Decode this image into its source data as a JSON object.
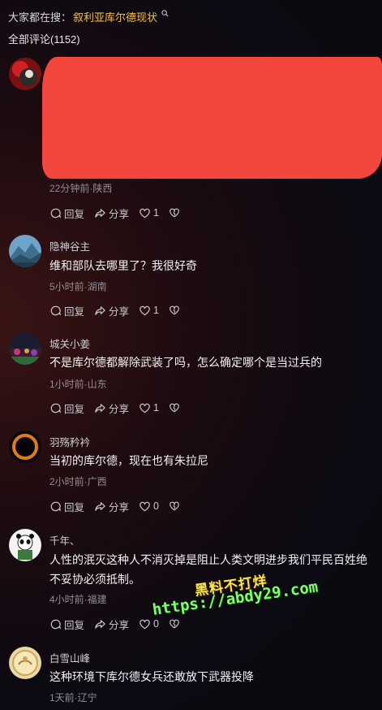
{
  "search": {
    "prefix": "大家都在搜：",
    "term": "叙利亚库尔德现状"
  },
  "comments_header": {
    "label": "全部评论(1152)"
  },
  "comments": [
    {
      "name": "",
      "text": "",
      "meta": "22分钟前·陕西",
      "reply_label": "回复",
      "share_label": "分享",
      "likes": "1"
    },
    {
      "name": "隐神谷主",
      "text": "维和部队去哪里了？我很好奇",
      "meta": "5小时前·湖南",
      "reply_label": "回复",
      "share_label": "分享",
      "likes": "1"
    },
    {
      "name": "城关小姜",
      "text": "不是库尔德都解除武装了吗，怎么确定哪个是当过兵的",
      "meta": "1小时前·山东",
      "reply_label": "回复",
      "share_label": "分享",
      "likes": "1"
    },
    {
      "name": "羽殇矜衿",
      "text": "当初的库尔德，现在也有朱拉尼",
      "meta": "2小时前·广西",
      "reply_label": "回复",
      "share_label": "分享",
      "likes": "0"
    },
    {
      "name": "千年、",
      "text": "人性的泯灭这种人不消灭掉是阻止人类文明进步我们平民百姓绝不妥协必须抵制。",
      "meta": "4小时前·福建",
      "reply_label": "回复",
      "share_label": "分享",
      "likes": "0"
    },
    {
      "name": "白雪山峰",
      "text": "这种环境下库尔德女兵还敢放下武器投降",
      "meta": "1天前·辽宁"
    }
  ],
  "watermark": {
    "title": "黑料不打烊",
    "url": "https://abdy29.com"
  },
  "colors": {
    "search_term": "#f0c14b",
    "redaction": "#f3473e",
    "watermark_title": "#ffe64a",
    "watermark_url": "#7dff6a"
  }
}
